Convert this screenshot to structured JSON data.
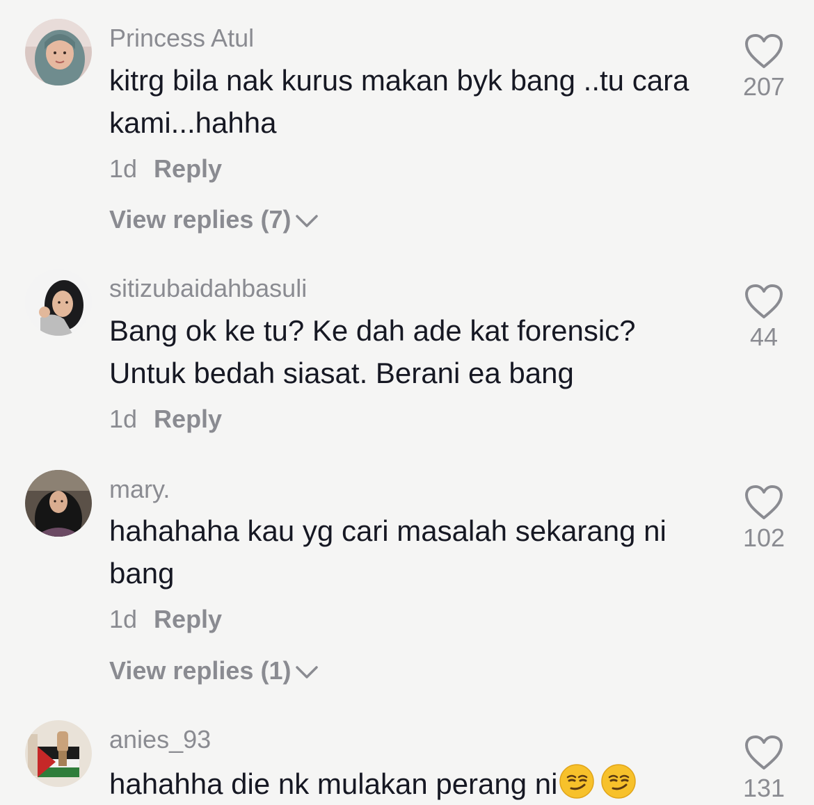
{
  "comments": [
    {
      "username": "Princess Atul",
      "text": "kitrg bila nak kurus makan byk bang ..tu cara kami...hahha",
      "time": "1d",
      "reply_label": "Reply",
      "view_replies": "View replies (7)",
      "likes": "207"
    },
    {
      "username": "sitizubaidahbasuli",
      "text": "Bang ok ke tu? Ke dah ade kat forensic? Untuk bedah siasat. Berani ea bang",
      "time": "1d",
      "reply_label": "Reply",
      "likes": "44"
    },
    {
      "username": "mary.",
      "text": "hahahaha kau yg cari masalah sekarang ni bang",
      "time": "1d",
      "reply_label": "Reply",
      "view_replies": "View replies (1)",
      "likes": "102"
    },
    {
      "username": "anies_93",
      "text": "hahahha die nk mulakan perang ni",
      "text_emoji": "smirking-face-emoji",
      "likes": "131"
    }
  ],
  "icons": {
    "like": "heart-outline-icon",
    "expand": "chevron-down-icon"
  },
  "colors": {
    "background": "#f5f5f4",
    "primary_text": "#161823",
    "secondary_text": "#8a8b91"
  }
}
